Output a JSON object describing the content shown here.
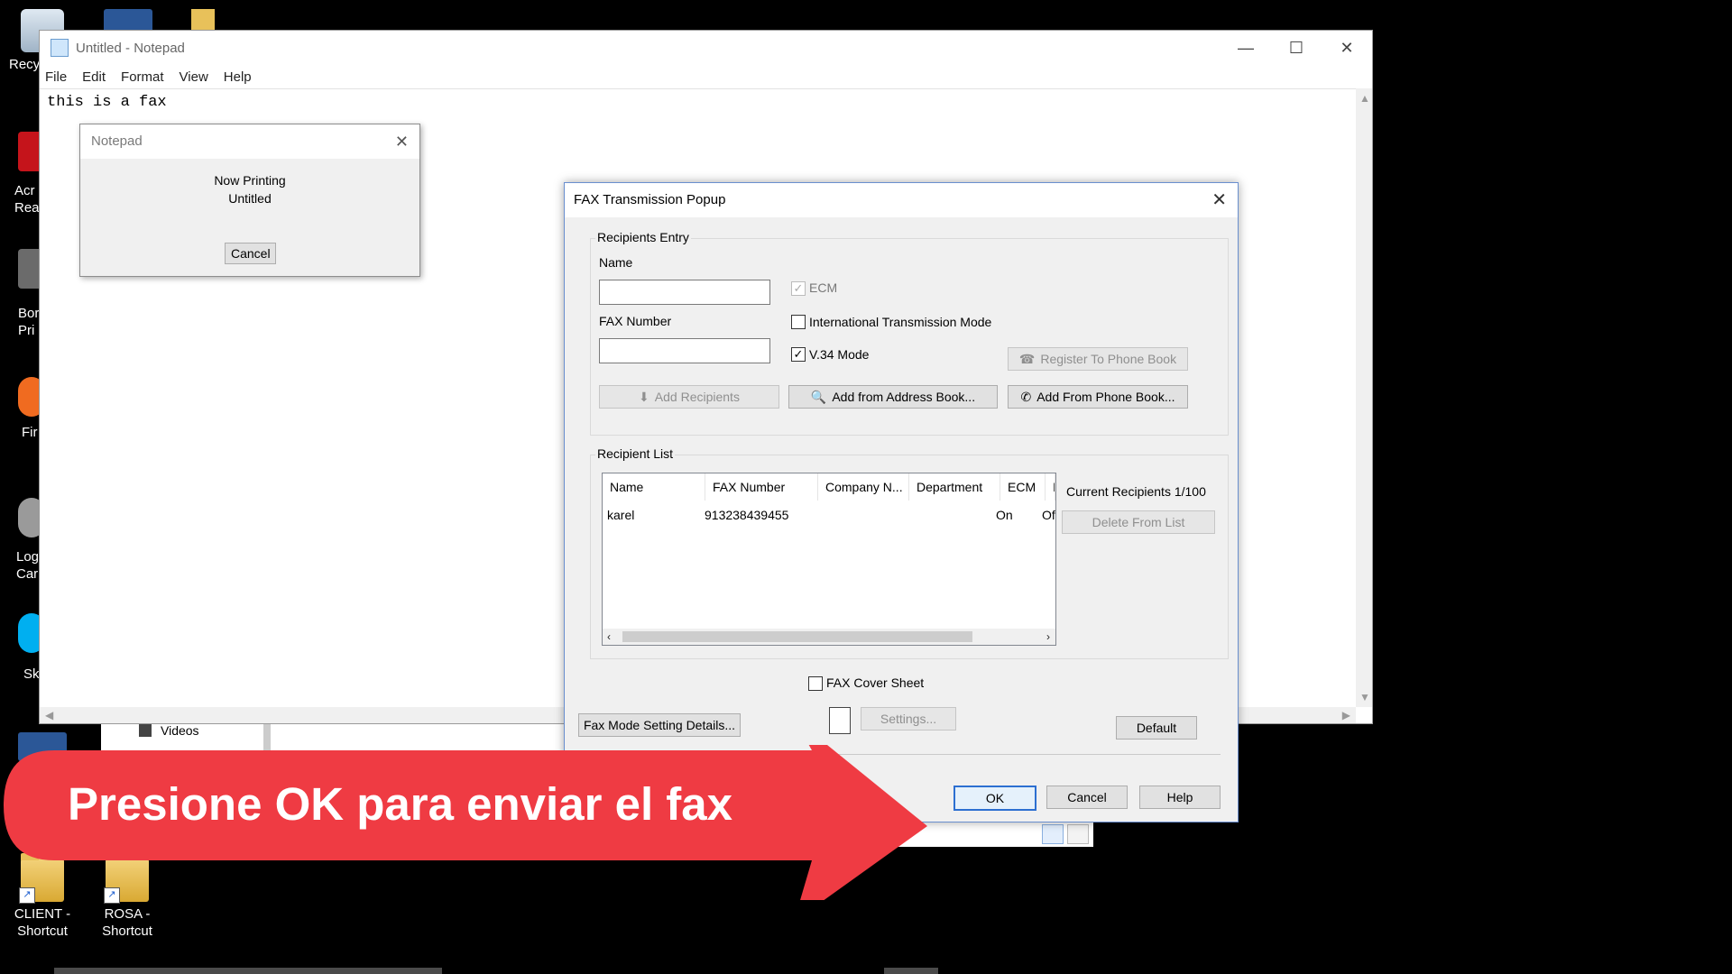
{
  "desktop": {
    "icons": [
      {
        "label": "Recy"
      },
      {
        "label": "Acr\nReac"
      },
      {
        "label": "Bor\nPri"
      },
      {
        "label": "Fir"
      },
      {
        "label": "Log\nCar"
      },
      {
        "label": "Sk"
      },
      {
        "label": "CLIENT -\nShortcut"
      },
      {
        "label": "ROSA -\nShortcut"
      }
    ]
  },
  "notepad": {
    "title": "Untitled - Notepad",
    "menu": [
      "File",
      "Edit",
      "Format",
      "View",
      "Help"
    ],
    "content": "this is a fax"
  },
  "print_dialog": {
    "title": "Notepad",
    "line1": "Now Printing",
    "line2": "Untitled",
    "cancel": "Cancel"
  },
  "behind_window": {
    "item": "Videos"
  },
  "fax": {
    "title": "FAX Transmission Popup",
    "recipients_entry": {
      "label": "Recipients Entry",
      "name_label": "Name",
      "name_value": "",
      "fax_label": "FAX Number",
      "fax_value": "",
      "ecm": "ECM",
      "intl": "International Transmission Mode",
      "v34": "V.34 Mode",
      "register": "Register To Phone Book",
      "add_recipients": "Add Recipients",
      "add_address": "Add from Address Book...",
      "add_phone": "Add From Phone Book..."
    },
    "recipient_list": {
      "label": "Recipient List",
      "columns": [
        "Name",
        "FAX Number",
        "Company N...",
        "Department",
        "ECM",
        "I"
      ],
      "rows": [
        {
          "name": "karel",
          "fax": "913238439455",
          "company": "",
          "department": "",
          "ecm": "On",
          "intl": "Of"
        }
      ],
      "current": "Current Recipients 1/100",
      "delete": "Delete From List"
    },
    "cover_sheet": "FAX Cover Sheet",
    "settings": "Settings...",
    "fax_mode": "Fax Mode Setting Details...",
    "default": "Default",
    "ok": "OK",
    "cancel": "Cancel",
    "help": "Help"
  },
  "callout": {
    "text": "Presione OK para enviar el fax",
    "color": "#ef3b43"
  }
}
